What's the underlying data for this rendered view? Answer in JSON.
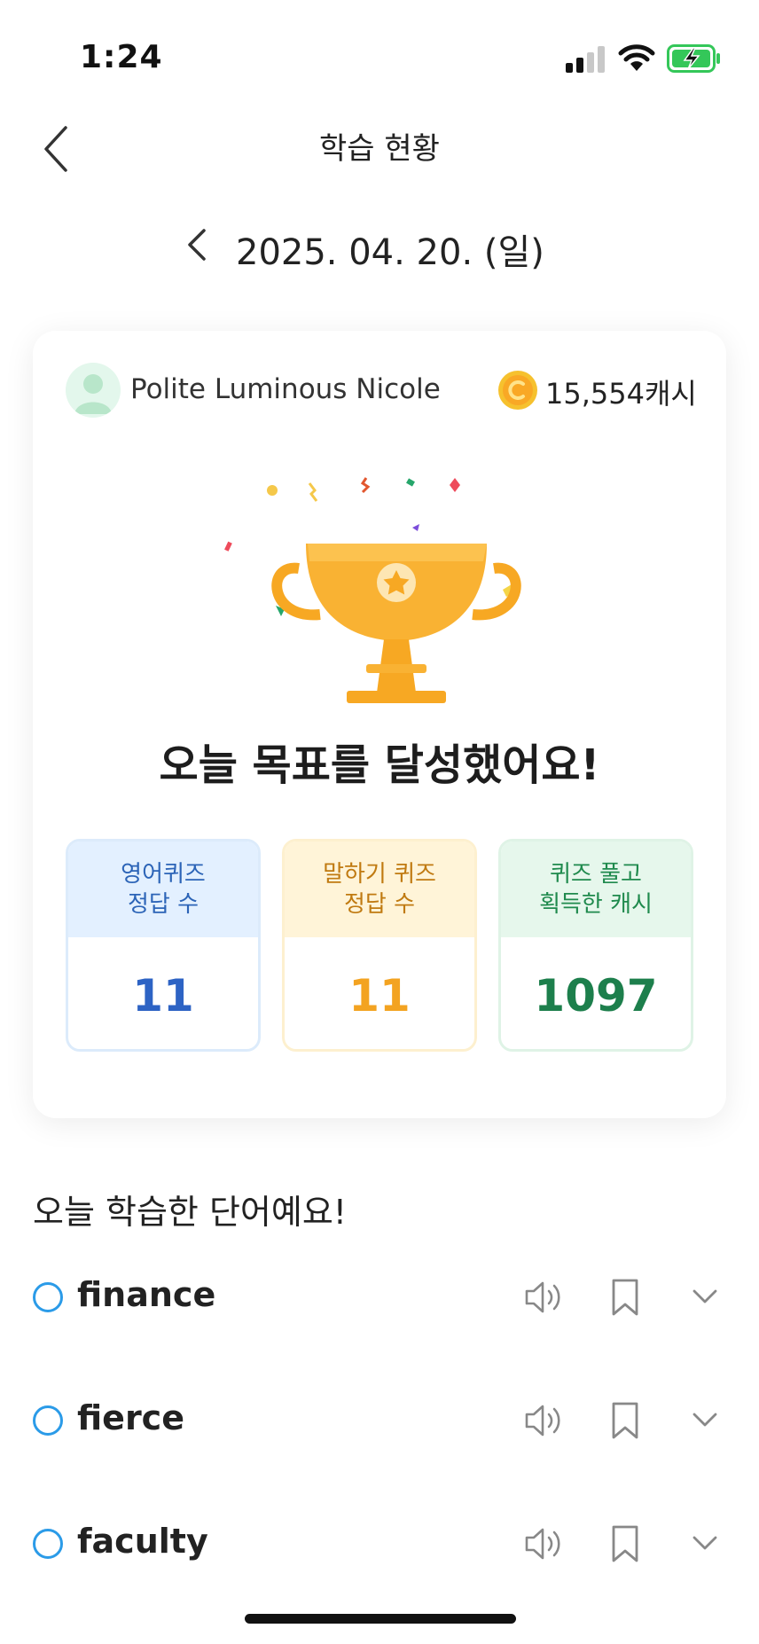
{
  "status_bar": {
    "time": "1:24"
  },
  "header": {
    "title": "학습 현황"
  },
  "date_nav": {
    "date": "2025. 04. 20. (일)"
  },
  "profile": {
    "name": "Polite Luminous Nicole",
    "cash": "15,554캐시"
  },
  "goal": {
    "message": "오늘 목표를 달성했어요!"
  },
  "stats": [
    {
      "label_line1": "영어퀴즈",
      "label_line2": "정답 수",
      "value": "11",
      "color": "#2d63c4"
    },
    {
      "label_line1": "말하기 퀴즈",
      "label_line2": "정답 수",
      "value": "11",
      "color": "#f3a321"
    },
    {
      "label_line1": "퀴즈 풀고",
      "label_line2": "획득한 캐시",
      "value": "1097",
      "color": "#1d7f4c"
    }
  ],
  "words_section": {
    "title": "오늘 학습한 단어예요!",
    "words": [
      "finance",
      "fierce",
      "faculty"
    ]
  },
  "icons": [
    "back-icon",
    "chevron-left-icon",
    "avatar-icon",
    "coin-icon",
    "trophy-icon",
    "speaker-icon",
    "bookmark-icon",
    "chevron-down-icon"
  ],
  "colors": {
    "accent_blue": "#2b9be8",
    "trophy": "#f7a823"
  }
}
